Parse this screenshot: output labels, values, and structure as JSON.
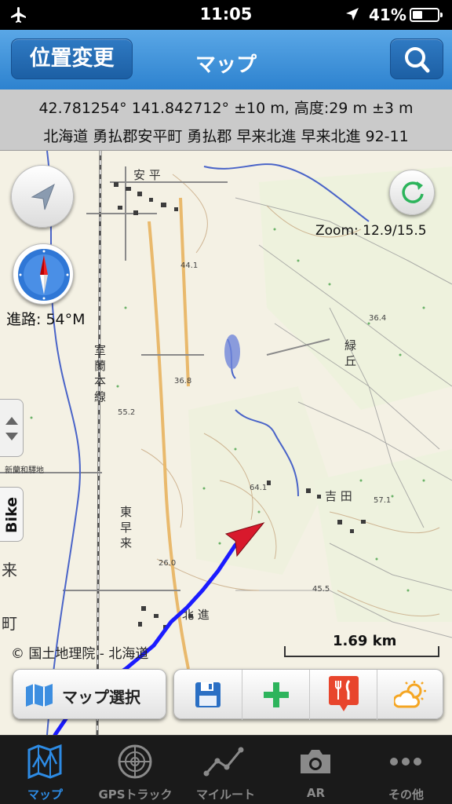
{
  "status_bar": {
    "time": "11:05",
    "battery": "41%",
    "battery_level": 0.41
  },
  "navbar": {
    "change_location_label": "位置変更",
    "title": "マップ"
  },
  "info": {
    "coords": "42.781254° 141.842712° ±10 m, 高度:29 m ±3 m",
    "address": "北海道 勇払郡安平町 勇払郡 早来北進 早来北進 92-11"
  },
  "map": {
    "zoom": "Zoom: 12.9/15.5",
    "heading": "進路: 54°M",
    "bike_label": "Bike",
    "scale": "1.69 km",
    "copyright": "© 国土地理院 - 北海道",
    "labels": {
      "aza_hei": "安 平",
      "ro_ran": "室 蘭 本 線",
      "hayakita": "東 早 来",
      "kita_shin": "北 進",
      "midorioka": "緑 丘",
      "yoshida": "吉 田",
      "rai": "来",
      "machi": "町",
      "elev_44": "44.1",
      "elev_36a": "36.4",
      "elev_36b": "36.8",
      "elev_55": "55.2",
      "elev_26": "26.0",
      "elev_64": "64.1",
      "elev_57": "57.1",
      "elev_45": "45.5",
      "station": "新蘭和驛地"
    },
    "map_select_label": "マップ選択"
  },
  "tools": [
    "save-icon",
    "add-icon",
    "restaurant-icon",
    "weather-icon"
  ],
  "tabs": [
    {
      "label": "マップ",
      "icon": "map-icon",
      "active": true
    },
    {
      "label": "GPSトラック",
      "icon": "radar-icon",
      "active": false
    },
    {
      "label": "マイルート",
      "icon": "route-icon",
      "active": false
    },
    {
      "label": "AR",
      "icon": "camera-icon",
      "active": false
    },
    {
      "label": "その他",
      "icon": "more-icon",
      "active": false
    }
  ],
  "colors": {
    "accent": "#2d8be4",
    "track": "#1b1bff",
    "heading_arrow": "#d8192c"
  }
}
